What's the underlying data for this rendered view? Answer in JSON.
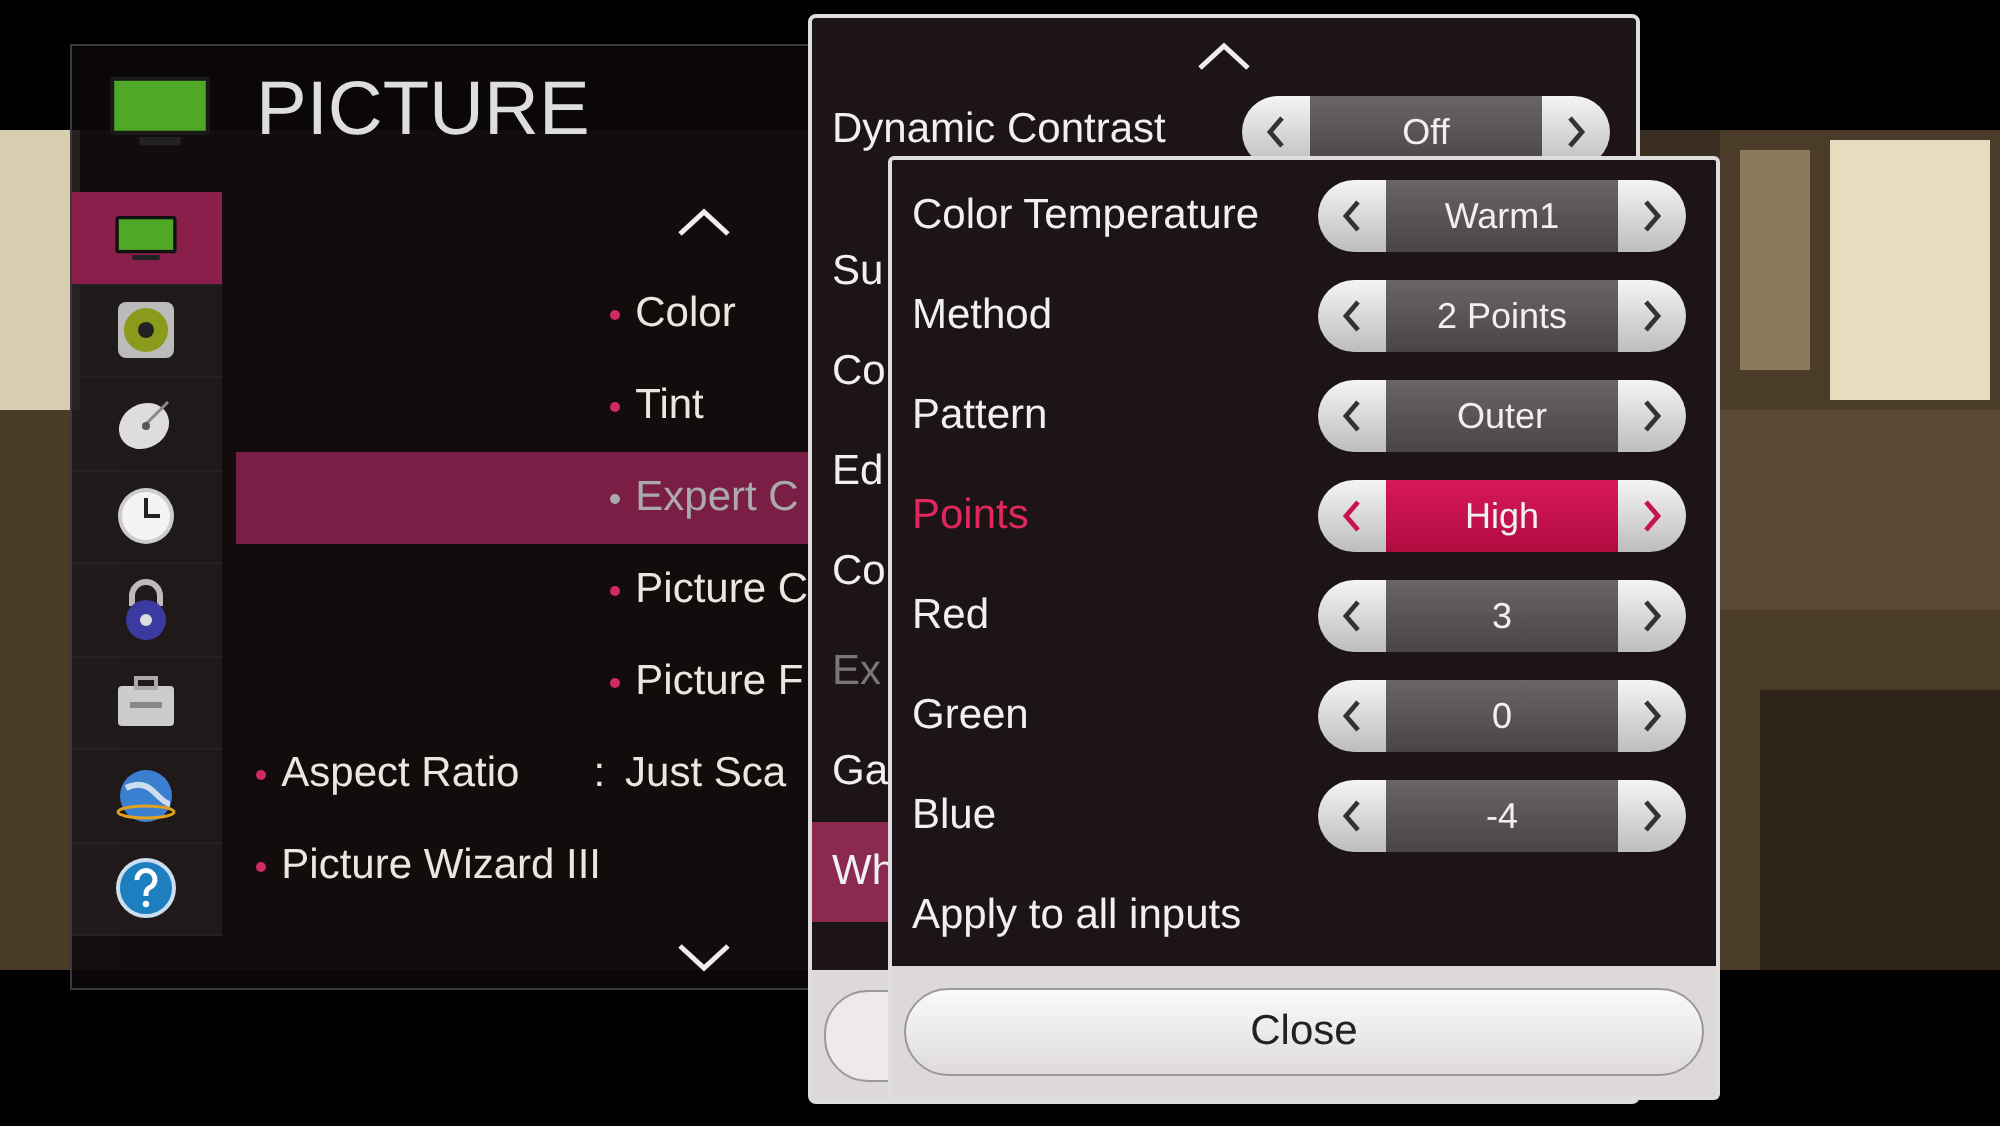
{
  "picture_menu": {
    "title": "PICTURE",
    "sidebar": [
      {
        "selected": true
      },
      {
        "selected": false
      },
      {
        "selected": false
      },
      {
        "selected": false
      },
      {
        "selected": false
      },
      {
        "selected": false
      },
      {
        "selected": false
      },
      {
        "selected": false
      }
    ],
    "items": [
      {
        "kind": "sub",
        "label": "Color",
        "selected": false
      },
      {
        "kind": "sub",
        "label": "Tint",
        "selected": false
      },
      {
        "kind": "sub",
        "label": "Expert C",
        "selected": true
      },
      {
        "kind": "sub",
        "label": "Picture C",
        "selected": false
      },
      {
        "kind": "sub",
        "label": "Picture F",
        "selected": false
      },
      {
        "kind": "main",
        "label": "Aspect Ratio",
        "separator": ":",
        "value": "Just Sca",
        "selected": false
      },
      {
        "kind": "main",
        "label": "Picture Wizard III",
        "selected": false
      }
    ]
  },
  "expert_menu": {
    "items": [
      {
        "label": "Dynamic Contrast",
        "value": "Off",
        "selected": false,
        "disabled": false
      },
      {
        "label": "Su",
        "selected": false,
        "disabled": false
      },
      {
        "label": "Co",
        "selected": false,
        "disabled": false
      },
      {
        "label": "Ed",
        "selected": false,
        "disabled": false
      },
      {
        "label": "Co",
        "selected": false,
        "disabled": false
      },
      {
        "label": "Ex",
        "selected": false,
        "disabled": true
      },
      {
        "label": "Ga",
        "selected": false,
        "disabled": false
      },
      {
        "label": "Wh",
        "selected": true,
        "disabled": false
      }
    ]
  },
  "white_balance": {
    "rows": [
      {
        "kind": "option",
        "label": "Color Temperature",
        "value": "Warm1",
        "selected": false
      },
      {
        "kind": "option",
        "label": "Method",
        "value": "2 Points",
        "selected": false
      },
      {
        "kind": "option",
        "label": "Pattern",
        "value": "Outer",
        "selected": false
      },
      {
        "kind": "option",
        "label": "Points",
        "value": "High",
        "selected": true
      },
      {
        "kind": "option",
        "label": "Red",
        "value": "3",
        "selected": false
      },
      {
        "kind": "option",
        "label": "Green",
        "value": "0",
        "selected": false
      },
      {
        "kind": "option",
        "label": "Blue",
        "value": "-4",
        "selected": false
      },
      {
        "kind": "action",
        "label": "Apply to all inputs",
        "selected": false
      }
    ],
    "close_button": "Close"
  }
}
